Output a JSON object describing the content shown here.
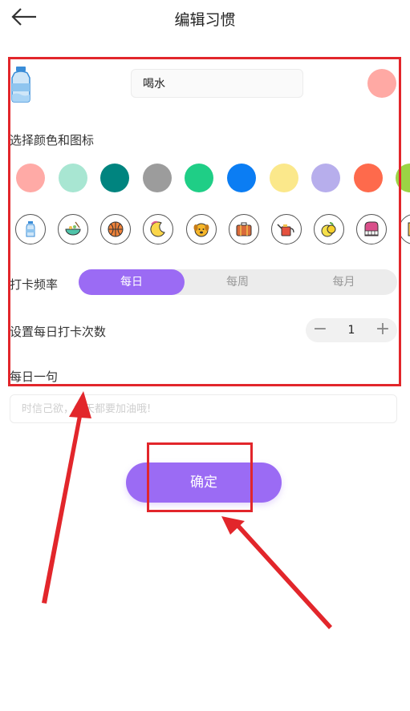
{
  "header": {
    "title": "编辑习惯"
  },
  "habit": {
    "name": "喝水",
    "selected_color": "#ffa9a4"
  },
  "sections": {
    "color_icon_label": "选择颜色和图标",
    "frequency_label": "打卡频率",
    "daily_count_label": "设置每日打卡次数",
    "quote_label": "每日一句"
  },
  "colors": [
    "#ffaaa6",
    "#a8e6d2",
    "#00847f",
    "#9c9c9c",
    "#1fce86",
    "#0b7df3",
    "#fbe88b",
    "#b7aeec",
    "#fe6a4c",
    "#9bd444"
  ],
  "icons": [
    {
      "name": "bottle-icon"
    },
    {
      "name": "bowl-icon"
    },
    {
      "name": "basketball-icon"
    },
    {
      "name": "moon-icon"
    },
    {
      "name": "dog-icon"
    },
    {
      "name": "suitcase-icon"
    },
    {
      "name": "watering-can-icon"
    },
    {
      "name": "lemon-icon"
    },
    {
      "name": "piano-icon"
    },
    {
      "name": "book-icon"
    }
  ],
  "frequency": {
    "tabs": [
      "每日",
      "每周",
      "每月"
    ],
    "active": "每日"
  },
  "stepper": {
    "value": "1",
    "minus": "−",
    "plus": "+"
  },
  "quote": {
    "placeholder": "时信己欲，每天都要加油哦!"
  },
  "confirm": {
    "label": "确定"
  },
  "annotation_color": "#e2262b"
}
